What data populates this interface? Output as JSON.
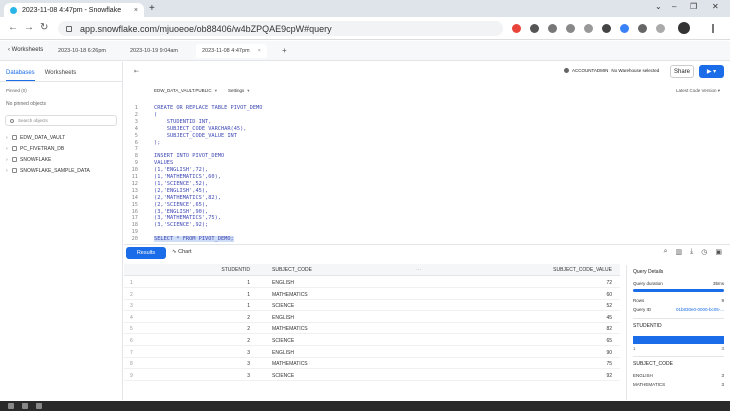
{
  "browser": {
    "tab_title": "2023-11-08 4:47pm - Snowflake",
    "tab_close": "×",
    "new_tab": "+",
    "url": "app.snowflake.com/mjuoeoe/ob88406/w4bZPQAE9cpW#query",
    "window_controls": [
      "⌄",
      "–",
      "❐",
      "✕"
    ]
  },
  "worksheet_bar": {
    "back_label": "‹  Worksheets",
    "tabs": [
      {
        "label": "2023-10-18 6:26pm"
      },
      {
        "label": "2023-10-19 9:04am"
      },
      {
        "label": "2023-11-08 4:47pm",
        "close": "×"
      }
    ],
    "add": "+"
  },
  "sidebar": {
    "tabs": [
      "Databases",
      "Worksheets"
    ],
    "pinned_label": "Pinned (0)",
    "no_pinned": "No pinned objects",
    "search_placeholder": "Search objects",
    "databases": [
      "EDW_DATA_VAULT",
      "PC_FIVETRAN_DB",
      "SNOWFLAKE",
      "SNOWFLAKE_SAMPLE_DATA"
    ]
  },
  "toolbar": {
    "collapse": "⇤",
    "role": "ACCOUNTADMIN",
    "warehouse": "No Warehouse selected",
    "share": "Share",
    "run": "▶",
    "run_menu": "▾",
    "context": "EDW_DATA_VAULT.PUBLIC",
    "settings": "Settings",
    "latest_version": "Latest Code Version"
  },
  "code_lines": [
    {
      "n": "1",
      "text": "CREATE OR REPLACE TABLE PIVOT_DEMO"
    },
    {
      "n": "2",
      "text": "("
    },
    {
      "n": "3",
      "text": "    STUDENTID INT,"
    },
    {
      "n": "4",
      "text": "    SUBJECT_CODE VARCHAR(45),"
    },
    {
      "n": "5",
      "text": "    SUBJECT_CODE_VALUE INT"
    },
    {
      "n": "6",
      "text": ");"
    },
    {
      "n": "7",
      "text": ""
    },
    {
      "n": "8",
      "text": "INSERT INTO PIVOT_DEMO"
    },
    {
      "n": "9",
      "text": "VALUES"
    },
    {
      "n": "10",
      "text": "(1,'ENGLISH',72),"
    },
    {
      "n": "11",
      "text": "(1,'MATHEMATICS',60),"
    },
    {
      "n": "12",
      "text": "(1,'SCIENCE',52),"
    },
    {
      "n": "13",
      "text": "(2,'ENGLISH',45),"
    },
    {
      "n": "14",
      "text": "(2,'MATHEMATICS',82),"
    },
    {
      "n": "15",
      "text": "(2,'SCIENCE',65),"
    },
    {
      "n": "16",
      "text": "(3,'ENGLISH',90),"
    },
    {
      "n": "17",
      "text": "(3,'MATHEMATICS',75),"
    },
    {
      "n": "18",
      "text": "(3,'SCIENCE',92);"
    },
    {
      "n": "19",
      "text": ""
    },
    {
      "n": "20",
      "text": "SELECT * FROM PIVOT_DEMO;"
    }
  ],
  "results": {
    "results_tab": "Results",
    "chart_tab": "Chart",
    "columns": [
      "STUDENTID",
      "SUBJECT_CODE",
      "···",
      "SUBJECT_CODE_VALUE"
    ],
    "rows": [
      {
        "n": "1",
        "id": "1",
        "subject": "ENGLISH",
        "value": "72"
      },
      {
        "n": "2",
        "id": "1",
        "subject": "MATHEMATICS",
        "value": "60"
      },
      {
        "n": "3",
        "id": "1",
        "subject": "SCIENCE",
        "value": "52"
      },
      {
        "n": "4",
        "id": "2",
        "subject": "ENGLISH",
        "value": "45"
      },
      {
        "n": "5",
        "id": "2",
        "subject": "MATHEMATICS",
        "value": "82"
      },
      {
        "n": "6",
        "id": "2",
        "subject": "SCIENCE",
        "value": "65"
      },
      {
        "n": "7",
        "id": "3",
        "subject": "ENGLISH",
        "value": "90"
      },
      {
        "n": "8",
        "id": "3",
        "subject": "MATHEMATICS",
        "value": "75"
      },
      {
        "n": "9",
        "id": "3",
        "subject": "SCIENCE",
        "value": "92"
      }
    ]
  },
  "query_details": {
    "title": "Query Details",
    "duration_label": "Query duration",
    "duration_value": "35ms",
    "rows_label": "Rows",
    "rows_value": "9",
    "query_id_label": "Query ID",
    "query_id_value": "01b830e0-0000-bc05-...",
    "col1": "STUDENTID",
    "col1_min": "1",
    "col1_max": "3",
    "col2": "SUBJECT_CODE",
    "col2_items": [
      {
        "label": "ENGLISH",
        "count": "3"
      },
      {
        "label": "MATHEMATICS",
        "count": "3"
      }
    ]
  },
  "colors": {
    "accent": "#1a6ce8",
    "code": "#3f4ab5"
  }
}
